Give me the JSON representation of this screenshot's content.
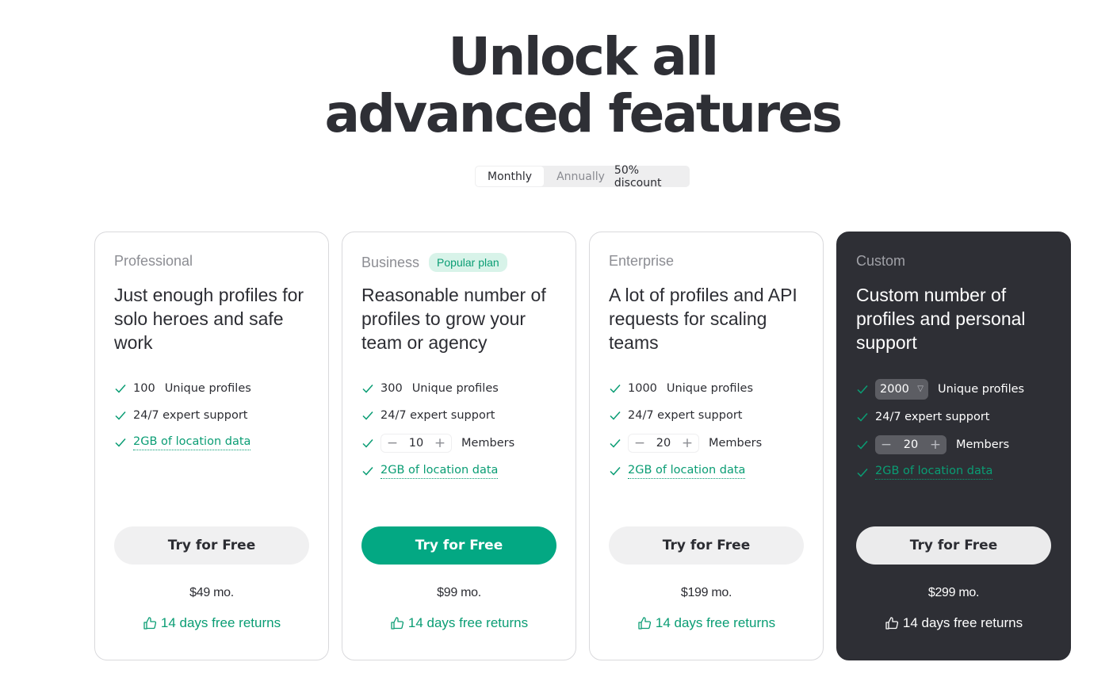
{
  "hero": {
    "line1": "Unlock all",
    "line2": "advanced features"
  },
  "billing": {
    "monthly": "Monthly",
    "annually": "Annually",
    "discount": "50% discount"
  },
  "colors": {
    "accent": "#03a883",
    "dark": "#2e2f35",
    "text": "#2c2d33"
  },
  "icons": {
    "check": "check-icon",
    "thumb": "thumbs-up-icon"
  },
  "plans": [
    {
      "name": "Professional",
      "description": "Just enough profiles for solo heroes and safe work",
      "profiles_count": "100",
      "profiles_label": "Unique profiles",
      "support": "24/7 expert support",
      "location": "2GB of location data",
      "cta": "Try for Free",
      "price": "$49 mo.",
      "returns": "14 days free returns"
    },
    {
      "name": "Business",
      "badge": "Popular plan",
      "description": "Reasonable number of profiles to grow your team or agency",
      "profiles_count": "300",
      "profiles_label": "Unique profiles",
      "support": "24/7 expert support",
      "members_value": "10",
      "members_label": "Members",
      "location": "2GB of location data",
      "cta": "Try for Free",
      "price": "$99 mo.",
      "returns": "14 days free returns"
    },
    {
      "name": "Enterprise",
      "description": "A lot of profiles and API requests for scaling teams",
      "profiles_count": "1000",
      "profiles_label": "Unique profiles",
      "support": "24/7 expert support",
      "members_value": "20",
      "members_label": "Members",
      "location": "2GB of location data",
      "cta": "Try for Free",
      "price": "$199 mo.",
      "returns": "14 days free returns"
    },
    {
      "name": "Custom",
      "description": "Custom number of profiles and personal support",
      "profiles_count": "2000",
      "profiles_label": "Unique profiles",
      "support": "24/7 expert support",
      "members_value": "20",
      "members_label": "Members",
      "location": "2GB of location data",
      "cta": "Try for Free",
      "price": "$299 mo.",
      "returns": "14 days free returns"
    }
  ]
}
